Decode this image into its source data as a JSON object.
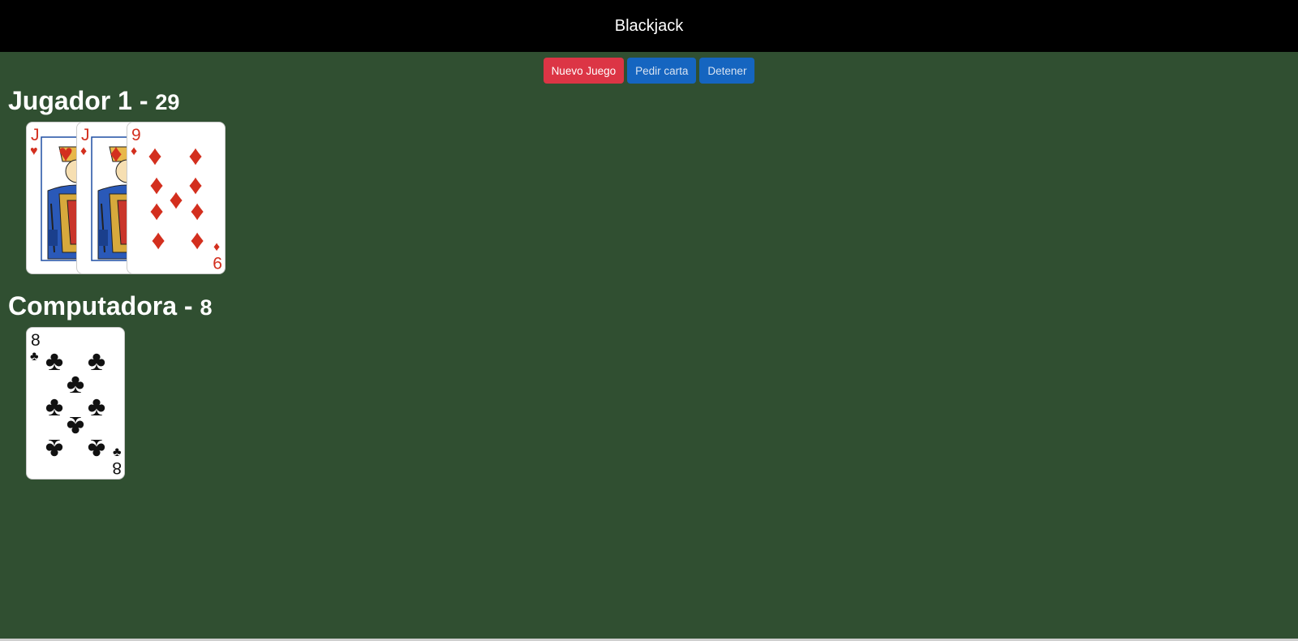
{
  "header": {
    "title": "Blackjack"
  },
  "controls": {
    "new_game_label": "Nuevo Juego",
    "hit_label": "Pedir carta",
    "stand_label": "Detener"
  },
  "players": [
    {
      "name": "Jugador 1",
      "separator": " - ",
      "score": "29",
      "cards": [
        {
          "rank": "J",
          "suit": "hearts"
        },
        {
          "rank": "J",
          "suit": "diamonds"
        },
        {
          "rank": "9",
          "suit": "diamonds"
        }
      ]
    },
    {
      "name": "Computadora",
      "separator": " - ",
      "score": "8",
      "cards": [
        {
          "rank": "8",
          "suit": "clubs"
        }
      ]
    }
  ],
  "colors": {
    "table": "#304f31",
    "red_suit": "#d32f1e",
    "black_suit": "#111111",
    "new_game_button": "#dc3545",
    "action_button": "#1565c0"
  }
}
